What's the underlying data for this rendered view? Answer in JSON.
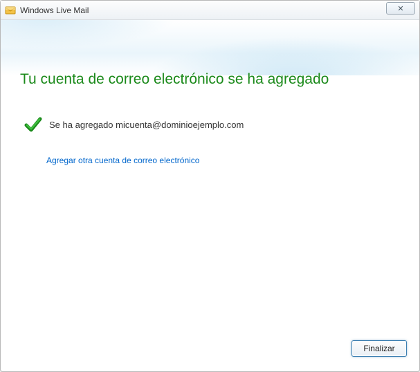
{
  "window": {
    "title": "Windows Live Mail",
    "close_glyph": "✕"
  },
  "main": {
    "heading": "Tu cuenta de correo electrónico se ha agregado",
    "status_prefix": "Se ha agregado ",
    "account_email": "micuenta@dominioejemplo.com",
    "add_another_link": "Agregar otra cuenta de correo electrónico"
  },
  "footer": {
    "finish_label": "Finalizar"
  },
  "colors": {
    "heading_green": "#1b8a1b",
    "link_blue": "#0066cc",
    "button_border": "#3c7fb1"
  }
}
